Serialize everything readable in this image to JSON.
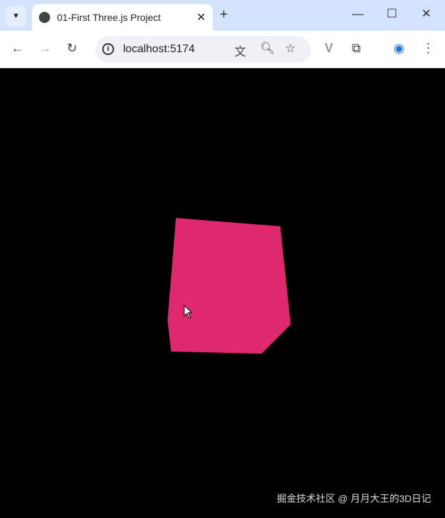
{
  "browser": {
    "tab_title": "01-First Three.js Project",
    "url": "localhost:5174"
  },
  "scene": {
    "cube_color": "#e0286e",
    "background": "#000000"
  },
  "watermark": "掘金技术社区 @ 月月大王的3D日记"
}
